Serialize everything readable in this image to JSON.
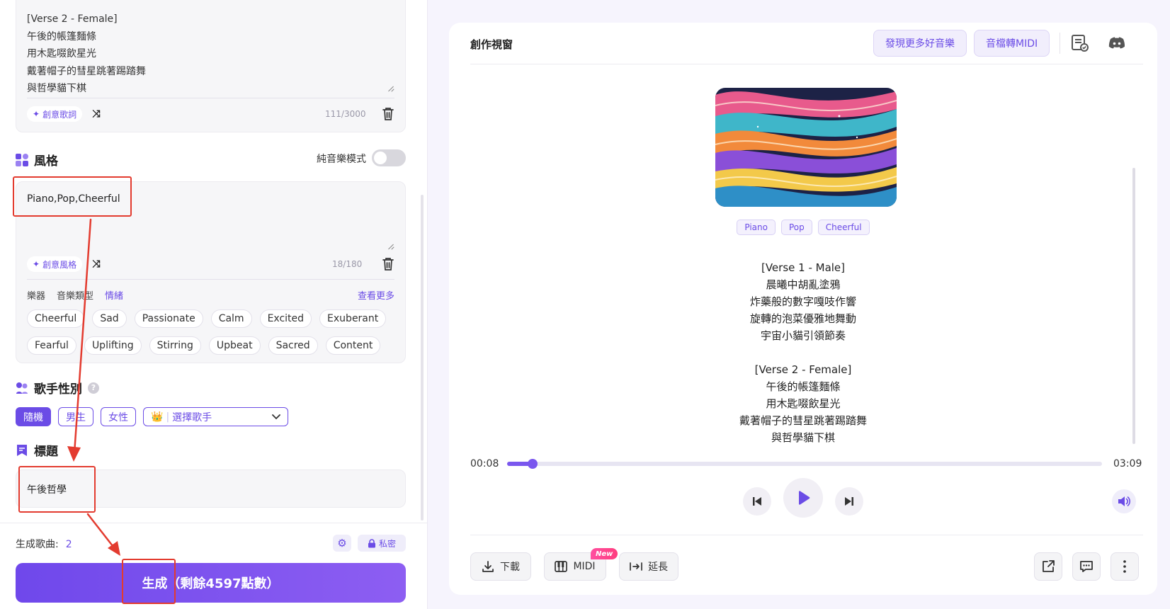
{
  "lyrics_editor": {
    "lines": [
      "[Verse 2 - Female]",
      "午後的帳篷麵條",
      "用木匙啜飲星光",
      "戴著帽子的彗星跳著踢踏舞",
      "與哲學貓下棋"
    ],
    "ai_button": "創意歌詞",
    "counter": "111/3000"
  },
  "style_section": {
    "title": "風格",
    "instrumental_label": "純音樂模式",
    "text": "Piano,Pop,Cheerful",
    "ai_button": "創意風格",
    "counter": "18/180",
    "categories": [
      "樂器",
      "音樂類型",
      "情緒"
    ],
    "see_more": "查看更多",
    "chips": [
      "Cheerful",
      "Sad",
      "Passionate",
      "Calm",
      "Excited",
      "Exuberant",
      "Fearful",
      "Uplifting",
      "Stirring",
      "Upbeat",
      "Sacred",
      "Content"
    ]
  },
  "singer_section": {
    "title": "歌手性別",
    "help": "?",
    "options": [
      "隨機",
      "男生",
      "女性"
    ],
    "select_placeholder": "選擇歌手"
  },
  "title_section": {
    "title": "標題",
    "value": "午後哲學"
  },
  "footer": {
    "generated_label": "生成歌曲:",
    "generated_count": "2",
    "private_label": "私密",
    "generate_button": "生成（剩餘4597點數）"
  },
  "right_panel": {
    "title": "創作視窗",
    "discover_button": "發現更多好音樂",
    "midi_button": "音檔轉MIDI",
    "tags": [
      "Piano",
      "Pop",
      "Cheerful"
    ],
    "lyrics_block1": [
      "[Verse 1 - Male]",
      "晨曦中胡亂塗鴉",
      "炸藥般的數字嘎吱作響",
      "旋轉的泡菜優雅地舞動",
      "宇宙小貓引領節奏"
    ],
    "lyrics_block2": [
      "[Verse 2 - Female]",
      "午後的帳篷麵條",
      "用木匙啜飲星光",
      "戴著帽子的彗星跳著踢踏舞",
      "與哲學貓下棋"
    ],
    "player": {
      "current_time": "00:08",
      "total_time": "03:09",
      "progress": 0.0423
    },
    "download_button": "下載",
    "midi_label": "MIDI",
    "new_badge": "New",
    "extend_button": "延長"
  },
  "colors": {
    "accent": "#6b4ce6",
    "annotation": "#e33b2f"
  }
}
